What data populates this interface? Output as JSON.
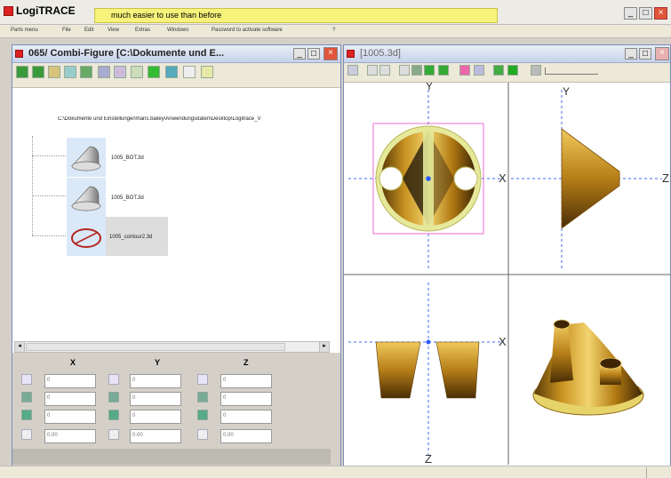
{
  "app": {
    "name": "LogiTRACE",
    "banner": "much easier to use than before"
  },
  "menu": [
    "Parts menu",
    "File",
    "Edit",
    "View",
    "Extras",
    "Windows",
    "Password to activate software",
    "?"
  ],
  "left_window": {
    "title": "065/ Combi-Figure  [C:\\Dokumente und E...",
    "path": "C:\\Dokumente und Einstellungen\\hans.bailey\\Anwendungsdaten\\Desktop\\Logitrace_V",
    "items": [
      {
        "label": "1005_BOT.3d",
        "icon": "cone-part-icon"
      },
      {
        "label": "1005_BOT.3d",
        "icon": "cone-part-icon"
      },
      {
        "label": "1005_contour2.3d",
        "icon": "contour-icon"
      }
    ],
    "axes": {
      "x": "X",
      "y": "Y",
      "z": "Z"
    },
    "fields": {
      "x": [
        "0",
        "0",
        "0",
        "0.00"
      ],
      "y": [
        "0",
        "0",
        "0",
        "0.00"
      ],
      "z": [
        "0",
        "0",
        "0",
        "0.00"
      ]
    }
  },
  "right_window": {
    "title": "[1005.3d]",
    "axis_labels": {
      "y1": "Y",
      "x1": "X",
      "y2": "Y",
      "z2": "Z",
      "x3": "X",
      "z3": "Z"
    }
  },
  "colors": {
    "banner": "#f6f27a",
    "gold": "#c89220",
    "accent_blue": "#2a5cff",
    "selection_magenta": "#ee6fd0"
  }
}
